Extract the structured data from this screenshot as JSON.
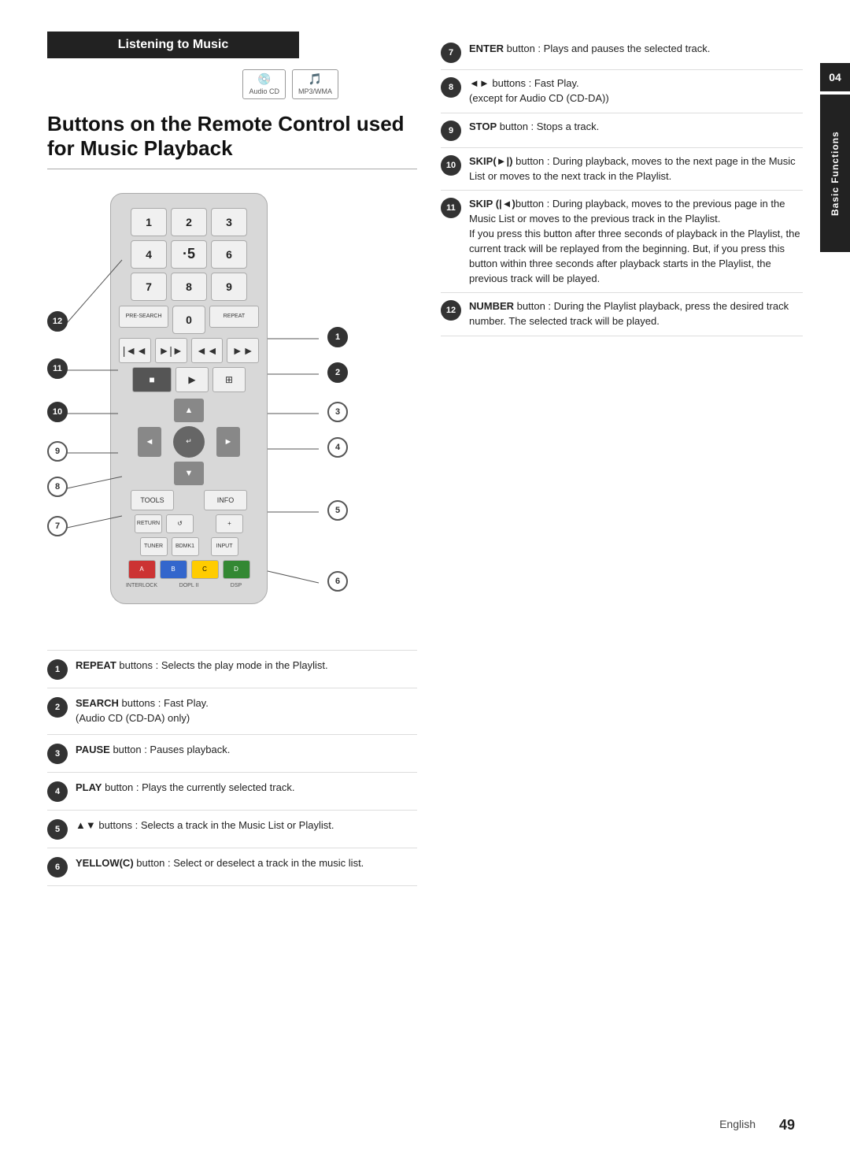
{
  "header": {
    "listening_label": "Listening to Music",
    "section_title": "Buttons on the Remote Control used for Music Playback",
    "audio_cd_label": "Audio CD",
    "mp3_wma_label": "MP3/WMA",
    "side_tab_number": "04",
    "side_tab_label": "Basic Functions"
  },
  "right_descriptions": [
    {
      "num": "7",
      "text_bold": "ENTER",
      "text": " button : Plays and pauses the selected track."
    },
    {
      "num": "8",
      "text_bold": "◄► ",
      "text": "buttons : Fast Play. (except for Audio CD (CD-DA))"
    },
    {
      "num": "9",
      "text_bold": "STOP",
      "text": " button : Stops a track."
    },
    {
      "num": "10",
      "text_bold": "SKIP(►|)",
      "text": " button : During playback, moves to the next page in the Music List or moves to the next track in the Playlist."
    },
    {
      "num": "11",
      "text_bold": "SKIP (|◄)",
      "text": "button : During playback, moves to the previous page in the Music List or moves to the previous track in the Playlist. If you press this button after three seconds of playback in the Playlist, the current track will be replayed from the beginning. But, if you press this button within three seconds after playback starts in the Playlist, the previous track will be played."
    },
    {
      "num": "12",
      "text_bold": "NUMBER",
      "text": " button : During the Playlist playback, press the desired track number. The selected track will be played."
    }
  ],
  "bottom_descriptions": [
    {
      "num": "1",
      "text_bold": "REPEAT",
      "text": " buttons : Selects the play mode in the Playlist."
    },
    {
      "num": "2",
      "text_bold": "SEARCH",
      "text": " buttons : Fast Play. (Audio CD (CD-DA) only)"
    },
    {
      "num": "3",
      "text_bold": "PAUSE",
      "text": " button : Pauses playback."
    },
    {
      "num": "4",
      "text_bold": "PLAY",
      "text": " button : Plays the currently selected track."
    },
    {
      "num": "5",
      "text_bold": "▲▼",
      "text": " buttons : Selects a track in the Music List or Playlist."
    },
    {
      "num": "6",
      "text_bold": "YELLOW(C)",
      "text": " button : Select or deselect a track in the music list."
    }
  ],
  "page": {
    "language": "English",
    "number": "49"
  },
  "remote": {
    "numpad": [
      [
        "1",
        "2",
        "3"
      ],
      [
        "4",
        "·5",
        "6"
      ],
      [
        "7",
        "8",
        "9"
      ],
      [
        "0"
      ]
    ],
    "special_btns": [
      "PRE-SEARCH",
      "REPEAT"
    ],
    "transport_btns": [
      "|◄◄",
      "►|►",
      "◄◄",
      "►►"
    ],
    "playback_btns": [
      "■",
      "►",
      "⊞"
    ],
    "tools_btns": [
      "TOOLS",
      "INFO"
    ],
    "bottom_btns": [
      "RETURN",
      "↺",
      "+",
      "TUNER",
      "BDMKI",
      "A",
      "B",
      "C",
      "D",
      "INTERLOCK",
      "DOPL II",
      "DSP"
    ],
    "label_rows": [
      "INTERLOCK",
      "DOPL II",
      "DSP"
    ]
  }
}
